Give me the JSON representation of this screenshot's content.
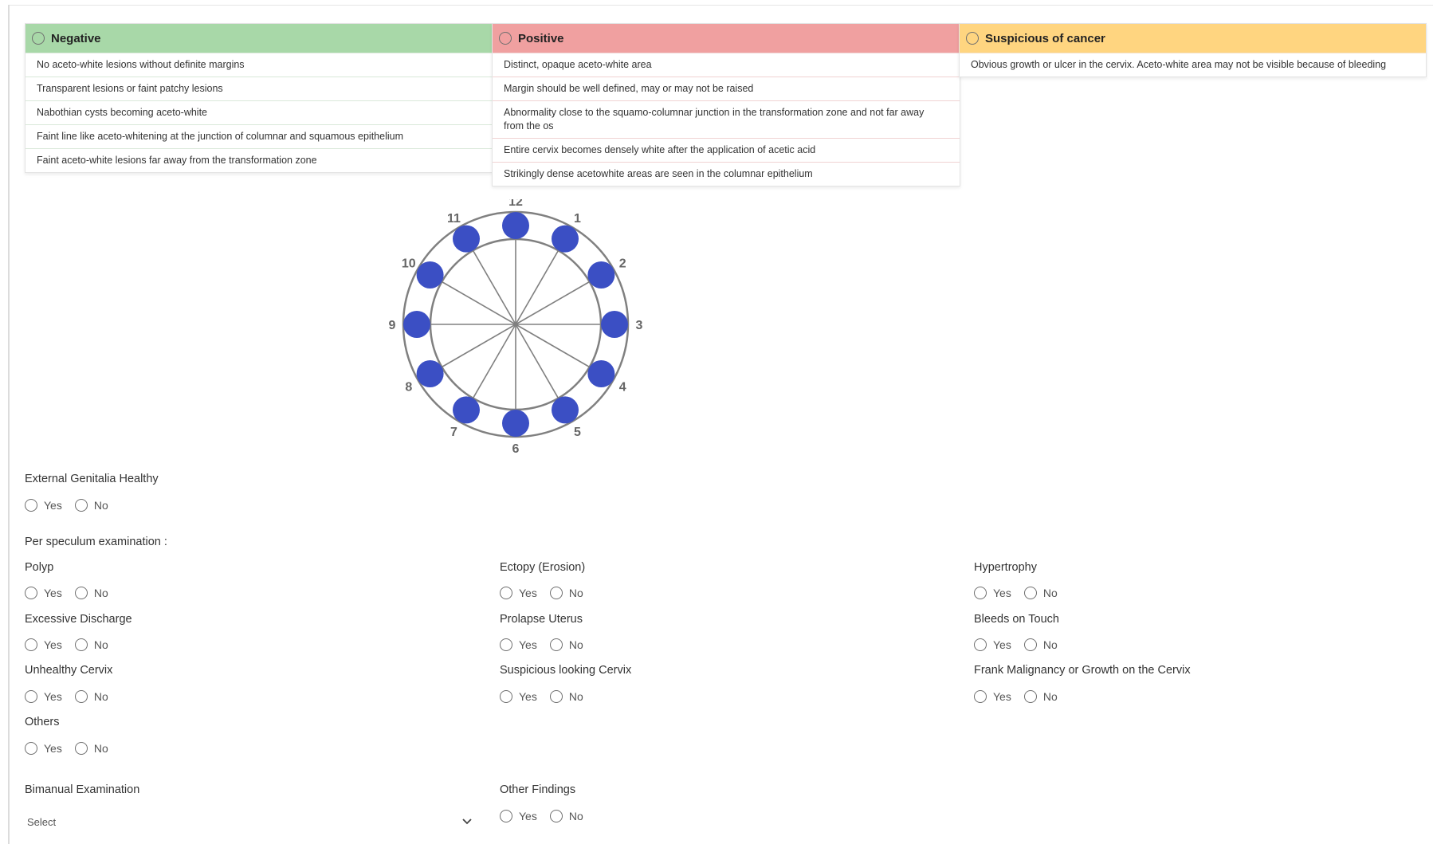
{
  "categories": [
    {
      "label": "Negative",
      "color": "#a8d8a8",
      "items": [
        "No aceto-white lesions without definite margins",
        "Transparent lesions or faint patchy lesions",
        "Nabothian cysts becoming aceto-white",
        "Faint line like aceto-whitening at the junction of columnar and squamous epithelium",
        "Faint aceto-white lesions far away from the transformation zone"
      ]
    },
    {
      "label": "Positive",
      "color": "#f0a0a0",
      "items": [
        "Distinct, opaque aceto-white area",
        "Margin should be well defined, may or may not be raised",
        "Abnormality close to the squamo-columnar junction in the transformation zone and not far away from the os",
        "Entire cervix becomes densely white after the application of acetic acid",
        "Strikingly dense acetowhite areas are seen in the columnar epithelium"
      ]
    },
    {
      "label": "Suspicious of cancer",
      "color": "#ffd580",
      "items": [
        "Obvious growth or ulcer in the cervix. Aceto-white area may not be visible because of bleeding"
      ]
    }
  ],
  "clock": {
    "hours": [
      "12",
      "1",
      "2",
      "3",
      "4",
      "5",
      "6",
      "7",
      "8",
      "9",
      "10",
      "11"
    ],
    "dot_color": "#3b4fc4"
  },
  "form": {
    "external_genitalia": {
      "label": "External Genitalia Healthy",
      "yes": "Yes",
      "no": "No"
    },
    "per_speculum_heading": "Per speculum examination :",
    "fields": [
      {
        "label": "Polyp",
        "yes": "Yes",
        "no": "No"
      },
      {
        "label": "Ectopy (Erosion)",
        "yes": "Yes",
        "no": "No"
      },
      {
        "label": "Hypertrophy",
        "yes": "Yes",
        "no": "No"
      },
      {
        "label": "Excessive Discharge",
        "yes": "Yes",
        "no": "No"
      },
      {
        "label": "Prolapse Uterus",
        "yes": "Yes",
        "no": "No"
      },
      {
        "label": "Bleeds on Touch",
        "yes": "Yes",
        "no": "No"
      },
      {
        "label": "Unhealthy Cervix",
        "yes": "Yes",
        "no": "No"
      },
      {
        "label": "Suspicious looking Cervix",
        "yes": "Yes",
        "no": "No"
      },
      {
        "label": "Frank Malignancy or Growth on the Cervix",
        "yes": "Yes",
        "no": "No"
      },
      {
        "label": "Others",
        "yes": "Yes",
        "no": "No"
      }
    ],
    "bimanual": {
      "label": "Bimanual Examination",
      "placeholder": "Select"
    },
    "other_findings": {
      "label": "Other Findings",
      "yes": "Yes",
      "no": "No"
    }
  }
}
